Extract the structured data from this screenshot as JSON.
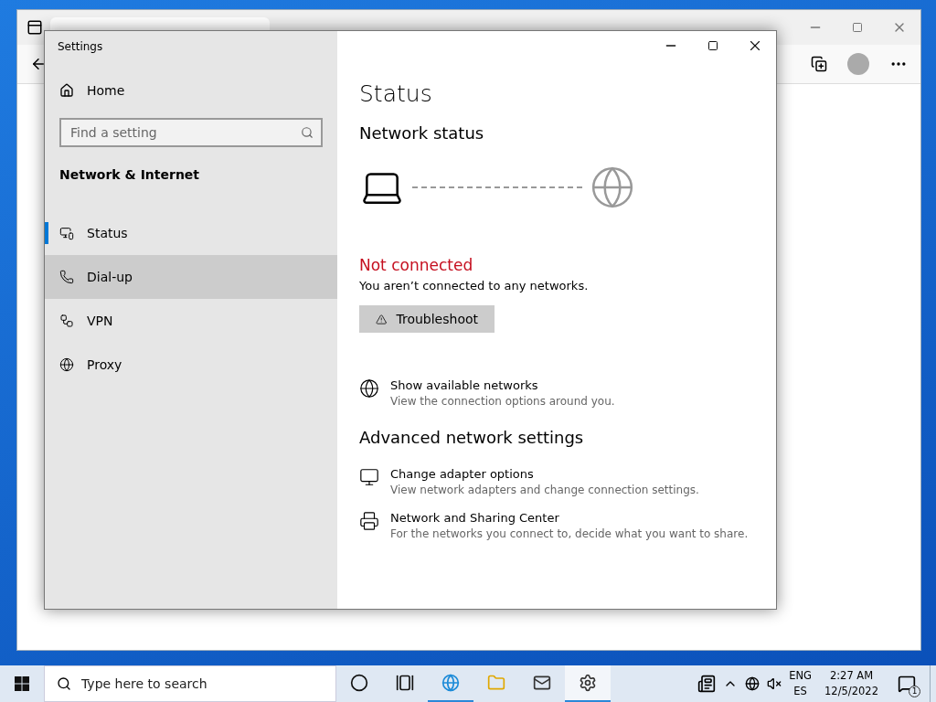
{
  "settings_window": {
    "title": "Settings",
    "sidebar": {
      "home": "Home",
      "search": {
        "placeholder": "Find a setting"
      },
      "section": "Network & Internet",
      "items": [
        {
          "label": "Status",
          "selected": true,
          "hovered": false
        },
        {
          "label": "Dial-up",
          "selected": false,
          "hovered": true
        },
        {
          "label": "VPN",
          "selected": false,
          "hovered": false
        },
        {
          "label": "Proxy",
          "selected": false,
          "hovered": false
        }
      ]
    },
    "content": {
      "title": "Status",
      "network_status": "Network status",
      "state": "Not connected",
      "message": "You aren’t connected to any networks.",
      "troubleshoot_button": "Troubleshoot",
      "links": [
        {
          "title": "Show available networks",
          "description": "View the connection options around you."
        }
      ],
      "advanced_heading": "Advanced network settings",
      "advanced_links": [
        {
          "title": "Change adapter options",
          "description": "View network adapters and change connection settings."
        },
        {
          "title": "Network and Sharing Center",
          "description": "For the networks you connect to, decide what you want to share."
        }
      ]
    }
  },
  "taskbar": {
    "search": {
      "placeholder": "Type here to search"
    },
    "apps": [
      {
        "running": false,
        "active": false
      },
      {
        "running": false,
        "active": false
      },
      {
        "running": true,
        "active": false
      },
      {
        "running": false,
        "active": false
      },
      {
        "running": false,
        "active": false
      },
      {
        "running": true,
        "active": true
      }
    ],
    "language": "ENG",
    "layout": "ES",
    "time": "2:27 AM",
    "date": "12/5/2022",
    "notifications": "1"
  }
}
